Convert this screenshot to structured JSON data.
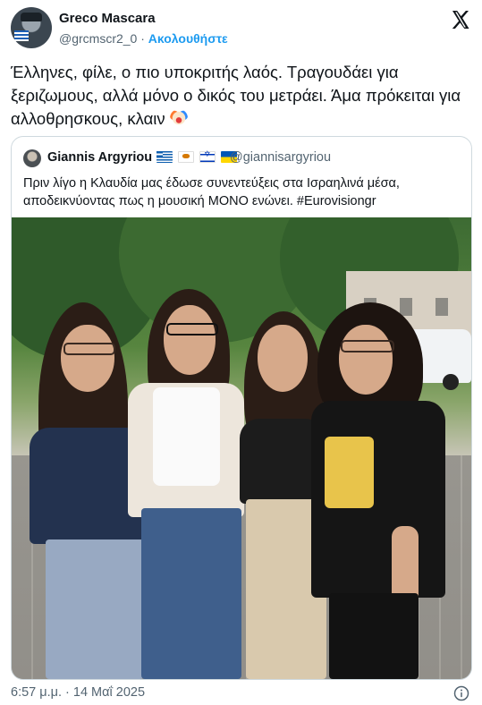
{
  "author": {
    "name": "Greco Mascara",
    "handle": "@grcmscr2_0",
    "separator": "·",
    "follow_label": "Ακολουθήστε"
  },
  "tweet": {
    "text": "Έλληνες, φίλε, ο πιο υποκριτής λαός. Τραγουδάει για ξεριζωμους, αλλά μόνο ο δικός του μετράει. Άμα πρόκειται για αλλοθρησκους, κλαιν",
    "emoji": "clown-face-icon"
  },
  "quoted": {
    "name": "Giannis Argyriou",
    "flags": [
      "flag-greece-icon",
      "flag-cyprus-icon",
      "flag-israel-icon",
      "flag-ukraine-icon"
    ],
    "handle": "@giannisargyriou",
    "text_line1": "Πριν λίγο η Κλαυδία μας έδωσε συνεντεύξεις στα Ισραηλινά μέσα,",
    "text_line2": "αποδεικνύοντας πως η μουσική ΜΟΝΟ ενώνει. #Eurovisiongr"
  },
  "footer": {
    "timestamp": "6:57 μ.μ. · 14 Μαΐ 2025"
  },
  "icons": {
    "platform": "x-logo-icon",
    "info": "info-icon"
  },
  "colors": {
    "link": "#1d9bf0",
    "muted": "#536471",
    "text": "#0f1419",
    "border": "#cfd9de"
  }
}
